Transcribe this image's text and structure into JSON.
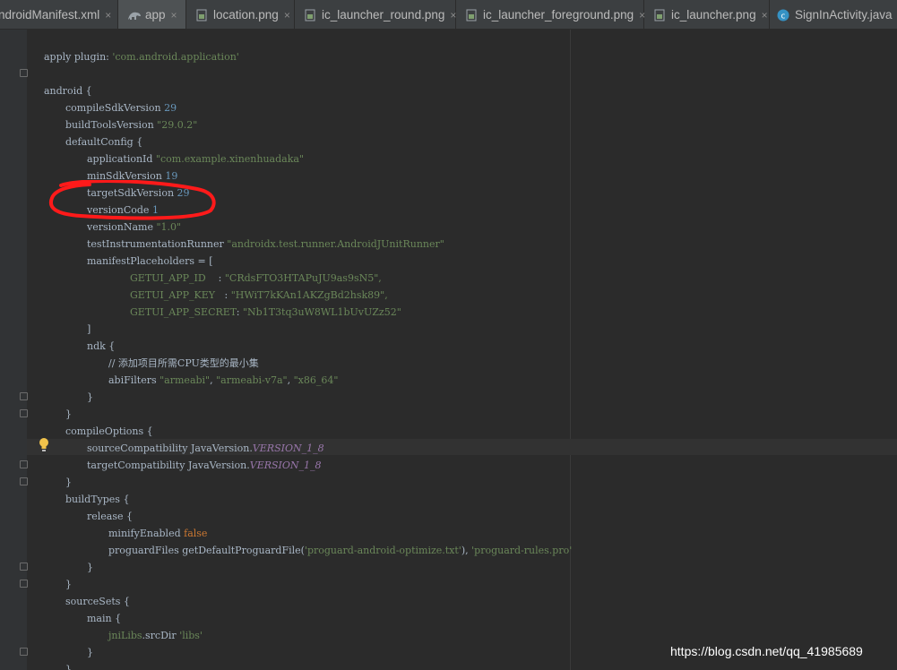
{
  "tabs": [
    {
      "label": "ndroidManifest.xml",
      "icon": "xml-file-icon"
    },
    {
      "label": "app",
      "icon": "gradle-icon",
      "active": true
    },
    {
      "label": "location.png",
      "icon": "image-file-icon"
    },
    {
      "label": "ic_launcher_round.png",
      "icon": "image-file-icon"
    },
    {
      "label": "ic_launcher_foreground.png",
      "icon": "image-file-icon"
    },
    {
      "label": "ic_launcher.png",
      "icon": "image-file-icon"
    },
    {
      "label": "SignInActivity.java",
      "icon": "java-class-icon"
    }
  ],
  "tab_close_glyph": "×",
  "code": {
    "l1": {
      "a": "apply ",
      "b": "plugin: ",
      "c": "'com.android.application'"
    },
    "l2": {
      "a": "android {"
    },
    "l3": {
      "a": "compileSdkVersion ",
      "b": "29"
    },
    "l4": {
      "a": "buildToolsVersion ",
      "b": "\"29.0.2\""
    },
    "l5": {
      "a": "defaultConfig {"
    },
    "l6": {
      "a": "applicationId ",
      "b": "\"com.example.xinenhuadaka\""
    },
    "l7": {
      "a": "minSdkVersion ",
      "b": "19"
    },
    "l8": {
      "a": "targetSdkVersion ",
      "b": "29"
    },
    "l9": {
      "a": "versionCode ",
      "b": "1"
    },
    "l10": {
      "a": "versionName ",
      "b": "\"1.0\""
    },
    "l11": {
      "a": "testInstrumentationRunner ",
      "b": "\"androidx.test.runner.AndroidJUnitRunner\""
    },
    "l12": {
      "a": "manifestPlaceholders = ["
    },
    "l13": {
      "a": "GETUI_APP_ID    ",
      "b": ": ",
      "c": "\"CRdsFTO3HTAPuJU9as9sN5\","
    },
    "l14": {
      "a": "GETUI_APP_KEY   ",
      "b": ": ",
      "c": "\"HWiT7kKAn1AKZgBd2hsk89\","
    },
    "l15": {
      "a": "GETUI_APP_SECRET",
      "b": ": ",
      "c": "\"Nb1T3tq3uW8WL1bUvUZz52\""
    },
    "l16": {
      "a": "]"
    },
    "l17": {
      "a": "ndk {"
    },
    "l18": {
      "a": "// 添加项目所需CPU类型的最小集"
    },
    "l19": {
      "a": "abiFilters ",
      "b": "\"armeabi\"",
      "c": ", ",
      "d": "\"armeabi-v7a\"",
      "e": ", ",
      "f": "\"x86_64\""
    },
    "l20": {
      "a": "}"
    },
    "l21": {
      "a": "}"
    },
    "l22": {
      "a": "compileOptions {"
    },
    "l23": {
      "a": "sourceCompatibility JavaVersion.",
      "b": "VERSION_1_8"
    },
    "l24": {
      "a": "targetCompatibility JavaVersion.",
      "b": "VERSION_1_8"
    },
    "l25": {
      "a": "}"
    },
    "l26": {
      "a": "buildTypes {"
    },
    "l27": {
      "a": "release {"
    },
    "l28": {
      "a": "minifyEnabled ",
      "b": "false"
    },
    "l29": {
      "a": "proguardFiles getDefaultProguardFile(",
      "b": "'proguard-android-optimize.txt'",
      "c": "), ",
      "d": "'proguard-rules.pro'"
    },
    "l30": {
      "a": "}"
    },
    "l31": {
      "a": "}"
    },
    "l32": {
      "a": "sourceSets {"
    },
    "l33": {
      "a": "main {"
    },
    "l34": {
      "a": "jniLibs",
      "b": ".srcDir ",
      "c": "'libs'"
    },
    "l35": {
      "a": "}"
    },
    "l36": {
      "a": "}"
    },
    "l37": {
      "a": "}"
    }
  },
  "watermark": "https://blog.csdn.net/qq_41985689",
  "colors": {
    "background": "#2b2b2b",
    "tabbar": "#3c3f41",
    "string": "#6a8759",
    "number": "#6897bb",
    "constant": "#9876aa",
    "keyword": "#cc7832",
    "annotation": "#ff1a1a"
  }
}
